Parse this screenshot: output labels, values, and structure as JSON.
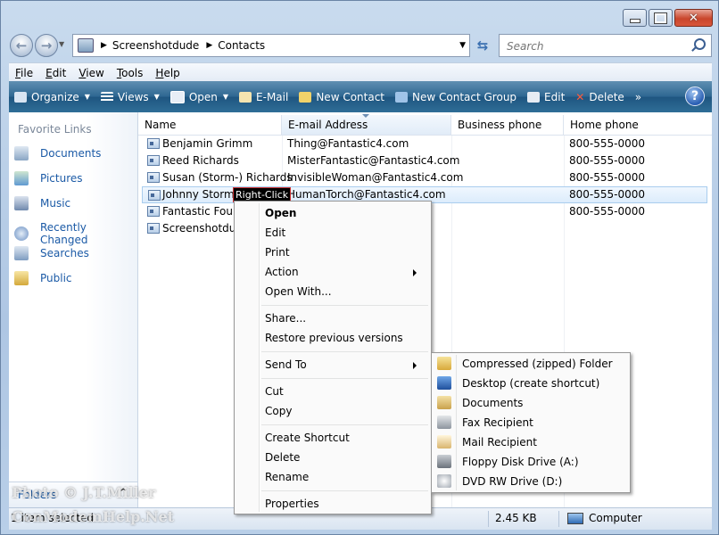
{
  "window": {
    "address": {
      "path": [
        "Screenshotdude",
        "Contacts"
      ]
    },
    "search": {
      "placeholder": "Search"
    },
    "caption": {
      "min": "—",
      "max": "□",
      "close": "✕"
    }
  },
  "menubar": [
    {
      "label": "File",
      "mnemonic": "F",
      "rest": "ile"
    },
    {
      "label": "Edit",
      "mnemonic": "E",
      "rest": "dit"
    },
    {
      "label": "View",
      "mnemonic": "V",
      "rest": "iew"
    },
    {
      "label": "Tools",
      "mnemonic": "T",
      "rest": "ools"
    },
    {
      "label": "Help",
      "mnemonic": "H",
      "rest": "elp"
    }
  ],
  "toolbar": {
    "organize": "Organize",
    "views": "Views",
    "open": "Open",
    "email": "E-Mail",
    "new_contact": "New Contact",
    "new_group": "New Contact Group",
    "edit": "Edit",
    "delete": "Delete",
    "more": "»",
    "help": "?"
  },
  "sidebar": {
    "title": "Favorite Links",
    "items": [
      {
        "label": "Documents"
      },
      {
        "label": "Pictures"
      },
      {
        "label": "Music"
      },
      {
        "label": "Recently Changed"
      },
      {
        "label": "Searches"
      },
      {
        "label": "Public"
      }
    ],
    "folders": "Folders",
    "folders_caret": "^"
  },
  "columns": {
    "name": "Name",
    "email": "E-mail Address",
    "business": "Business phone",
    "home": "Home phone"
  },
  "contacts": [
    {
      "name": "Benjamin Grimm",
      "email": "Thing@Fantastic4.com",
      "business": "",
      "home": "800-555-0000"
    },
    {
      "name": "Reed Richards",
      "email": "MisterFantastic@Fantastic4.com",
      "business": "",
      "home": "800-555-0000"
    },
    {
      "name": "Susan (Storm-) Richards",
      "email": "InvisibleWoman@Fantastic4.com",
      "business": "",
      "home": "800-555-0000"
    },
    {
      "name": "Johnny Storm",
      "email": "HumanTorch@Fantastic4.com",
      "business": "",
      "home": "800-555-0000"
    },
    {
      "name": "Fantastic Four",
      "email": "",
      "business": "",
      "home": "800-555-0000"
    },
    {
      "name": "Screenshotdude",
      "email": "",
      "business": "",
      "home": ""
    }
  ],
  "annotation": "Right-Click",
  "context_menu": {
    "open": "Open",
    "edit": "Edit",
    "print": "Print",
    "action": "Action",
    "open_with": "Open With...",
    "share": "Share...",
    "restore": "Restore previous versions",
    "send_to": "Send To",
    "cut": "Cut",
    "copy": "Copy",
    "create_shortcut": "Create Shortcut",
    "delete": "Delete",
    "rename": "Rename",
    "properties": "Properties"
  },
  "send_to_menu": [
    {
      "label": "Compressed (zipped) Folder",
      "icon": "zip-folder-icon",
      "color": "#e8c65a"
    },
    {
      "label": "Desktop (create shortcut)",
      "icon": "desktop-icon",
      "color": "#2d63b3"
    },
    {
      "label": "Documents",
      "icon": "documents-icon",
      "color": "#d9b461"
    },
    {
      "label": "Fax Recipient",
      "icon": "fax-icon",
      "color": "#9aa3ad"
    },
    {
      "label": "Mail Recipient",
      "icon": "mail-icon",
      "color": "#e6c887"
    },
    {
      "label": "Floppy Disk Drive (A:)",
      "icon": "floppy-icon",
      "color": "#8a9099"
    },
    {
      "label": "DVD RW Drive (D:)",
      "icon": "dvd-icon",
      "color": "#b9bfc6"
    }
  ],
  "status": {
    "selected": "1 item selected",
    "size": "2.45 KB",
    "location": "Computer"
  },
  "watermark": {
    "line1": "Photo © J.T.Miller",
    "line2": "ConModemHelp.Net"
  }
}
